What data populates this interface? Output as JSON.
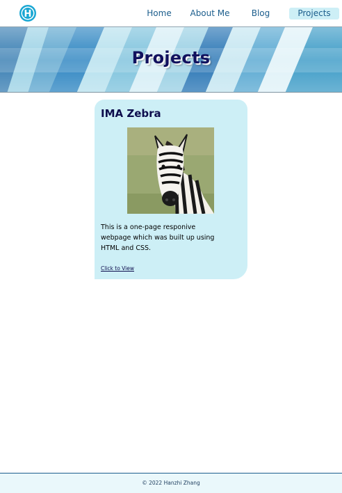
{
  "header": {
    "logo_letter": "H",
    "nav": [
      {
        "label": "Home"
      },
      {
        "label": "About Me"
      },
      {
        "label": "Blog"
      },
      {
        "label": "Projects",
        "active": true
      }
    ]
  },
  "banner": {
    "title": "Projects"
  },
  "projects": [
    {
      "title": "IMA Zebra",
      "image": "zebra-photo",
      "description": "This is a one-page responive webpage which was built up using HTML and CSS.",
      "link_label": "Click to View"
    }
  ],
  "footer": {
    "text": "© 2022 Hanzhi Zhang"
  },
  "colors": {
    "nav_text": "#1b5d8c",
    "nav_active_bg": "#cdeff6",
    "card_bg": "#cdeff6",
    "title_navy": "#11115e",
    "footer_bg": "#eaf8fb",
    "logo": "#1aa7d3"
  }
}
